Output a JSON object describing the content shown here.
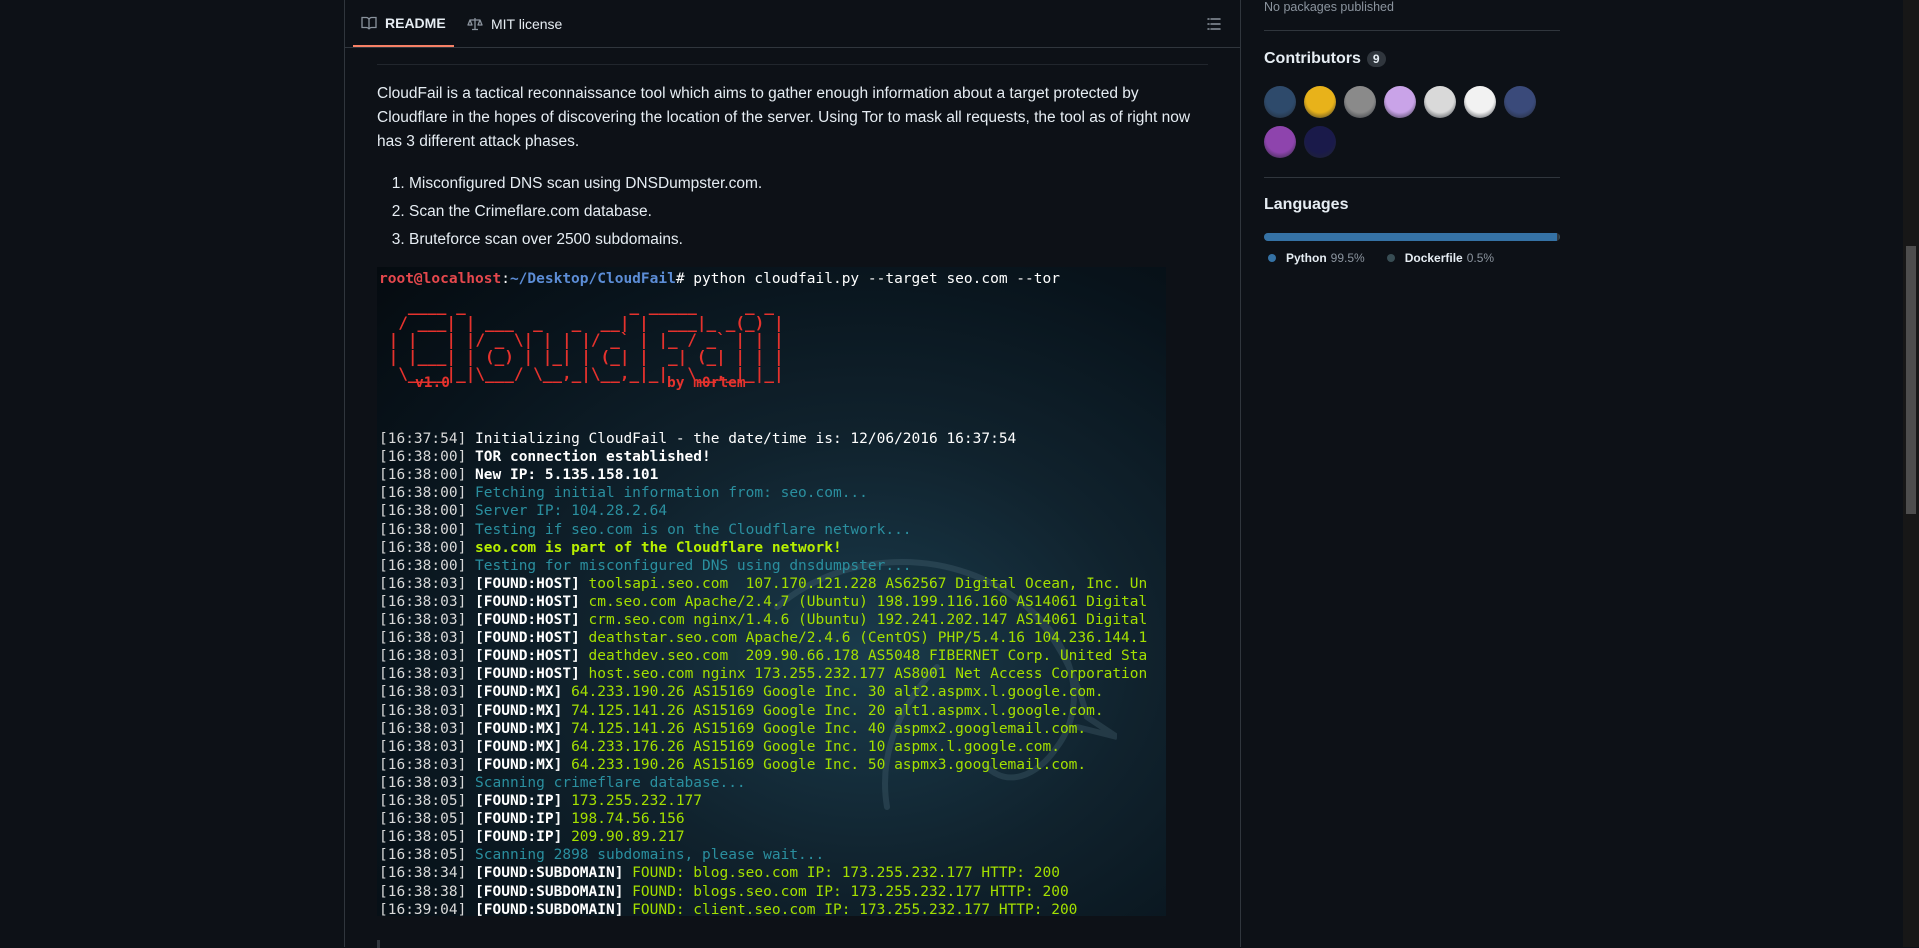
{
  "tabs": {
    "readme": "README",
    "license": "MIT license"
  },
  "intro": "CloudFail is a tactical reconnaissance tool which aims to gather enough information about a target protected by Cloudflare in the hopes of discovering the location of the server. Using Tor to mask all requests, the tool as of right now has 3 different attack phases.",
  "phases": [
    "Misconfigured DNS scan using DNSDumpster.com.",
    "Scan the Crimeflare.com database.",
    "Bruteforce scan over 2500 subdomains."
  ],
  "terminal": {
    "prompt_user": "root@localhost",
    "prompt_sep": ":",
    "prompt_path": "~/Desktop/CloudFail",
    "prompt_cmd": "# python cloudfail.py --target seo.com --tor",
    "ascii_art": "   ____ _                 _ _____     _ _ \n  / ___| | ___  _   _  __| |  ___|_ _(_) |\n | |   | |/ _ \\| | | |/ _` | |_ / _` | | |\n | |___| | (_) | |_| | (_| |  _| (_| | | |\n  \\____|_|\\___/ \\__,_|\\__,_|_|  \\__,_|_|_|",
    "version": "v1.0",
    "author": "by m0rtem",
    "lines": [
      {
        "ts": "[16:37:54]",
        "tag": "",
        "text": " Initializing CloudFail - the date/time is: 12/06/2016 16:37:54",
        "style": "white"
      },
      {
        "ts": "[16:38:00]",
        "tag": "",
        "text": " TOR connection established!",
        "style": "bold"
      },
      {
        "ts": "[16:38:00]",
        "tag": "",
        "text": " New IP: 5.135.158.101",
        "style": "bold"
      },
      {
        "ts": "[16:38:00]",
        "tag": "",
        "text": " Fetching initial information from: seo.com...",
        "style": "cyan"
      },
      {
        "ts": "[16:38:00]",
        "tag": "",
        "text": " Server IP: 104.28.2.64",
        "style": "cyan"
      },
      {
        "ts": "[16:38:00]",
        "tag": "",
        "text": " Testing if seo.com is on the Cloudflare network...",
        "style": "cyan"
      },
      {
        "ts": "[16:38:00]",
        "tag": "",
        "text": " seo.com is part of the Cloudflare network!",
        "style": "greenb"
      },
      {
        "ts": "[16:38:00]",
        "tag": "",
        "text": " Testing for misconfigured DNS using dnsdumpster...",
        "style": "cyan"
      },
      {
        "ts": "[16:38:03]",
        "tag": " [FOUND:HOST]",
        "text": " toolsapi.seo.com  107.170.121.228 AS62567 Digital Ocean, Inc. Un",
        "style": "green"
      },
      {
        "ts": "[16:38:03]",
        "tag": " [FOUND:HOST]",
        "text": " cm.seo.com Apache/2.4.7 (Ubuntu) 198.199.116.160 AS14061 Digital",
        "style": "green"
      },
      {
        "ts": "[16:38:03]",
        "tag": " [FOUND:HOST]",
        "text": " crm.seo.com nginx/1.4.6 (Ubuntu) 192.241.202.147 AS14061 Digital",
        "style": "green"
      },
      {
        "ts": "[16:38:03]",
        "tag": " [FOUND:HOST]",
        "text": " deathstar.seo.com Apache/2.4.6 (CentOS) PHP/5.4.16 104.236.144.1",
        "style": "green"
      },
      {
        "ts": "[16:38:03]",
        "tag": " [FOUND:HOST]",
        "text": " deathdev.seo.com  209.90.66.178 AS5048 FIBERNET Corp. United Sta",
        "style": "green"
      },
      {
        "ts": "[16:38:03]",
        "tag": " [FOUND:HOST]",
        "text": " host.seo.com nginx 173.255.232.177 AS8001 Net Access Corporation",
        "style": "green"
      },
      {
        "ts": "[16:38:03]",
        "tag": " [FOUND:MX]",
        "text": " 64.233.190.26 AS15169 Google Inc. 30 alt2.aspmx.l.google.com.",
        "style": "green"
      },
      {
        "ts": "[16:38:03]",
        "tag": " [FOUND:MX]",
        "text": " 74.125.141.26 AS15169 Google Inc. 20 alt1.aspmx.l.google.com.",
        "style": "green"
      },
      {
        "ts": "[16:38:03]",
        "tag": " [FOUND:MX]",
        "text": " 74.125.141.26 AS15169 Google Inc. 40 aspmx2.googlemail.com.",
        "style": "green"
      },
      {
        "ts": "[16:38:03]",
        "tag": " [FOUND:MX]",
        "text": " 64.233.176.26 AS15169 Google Inc. 10 aspmx.l.google.com.",
        "style": "green"
      },
      {
        "ts": "[16:38:03]",
        "tag": " [FOUND:MX]",
        "text": " 64.233.190.26 AS15169 Google Inc. 50 aspmx3.googlemail.com.",
        "style": "green"
      },
      {
        "ts": "[16:38:03]",
        "tag": "",
        "text": " Scanning crimeflare database...",
        "style": "cyan"
      },
      {
        "ts": "[16:38:05]",
        "tag": " [FOUND:IP]",
        "text": " 173.255.232.177",
        "style": "green"
      },
      {
        "ts": "[16:38:05]",
        "tag": " [FOUND:IP]",
        "text": " 198.74.56.156",
        "style": "green"
      },
      {
        "ts": "[16:38:05]",
        "tag": " [FOUND:IP]",
        "text": " 209.90.89.217",
        "style": "green"
      },
      {
        "ts": "[16:38:05]",
        "tag": "",
        "text": " Scanning 2898 subdomains, please wait...",
        "style": "cyan"
      },
      {
        "ts": "[16:38:34]",
        "tag": " [FOUND:SUBDOMAIN]",
        "text": " FOUND: blog.seo.com IP: 173.255.232.177 HTTP: 200",
        "style": "green"
      },
      {
        "ts": "[16:38:38]",
        "tag": " [FOUND:SUBDOMAIN]",
        "text": " FOUND: blogs.seo.com IP: 173.255.232.177 HTTP: 200",
        "style": "green"
      },
      {
        "ts": "[16:39:04]",
        "tag": " [FOUND:SUBDOMAIN]",
        "text": " FOUND: client.seo.com IP: 173.255.232.177 HTTP: 200",
        "style": "green"
      }
    ]
  },
  "sidebar": {
    "packages_text": "No packages published",
    "contributors_title": "Contributors",
    "contributors_count": "9",
    "contributors": [
      {
        "name": "contributor-1",
        "color": "#2e4a6b"
      },
      {
        "name": "contributor-2",
        "color": "#e8b21a"
      },
      {
        "name": "contributor-3",
        "color": "#8a8a8a"
      },
      {
        "name": "contributor-4",
        "color": "#c9a3e8"
      },
      {
        "name": "contributor-5",
        "color": "#d9d9d9"
      },
      {
        "name": "contributor-6",
        "color": "#f2f2f2"
      },
      {
        "name": "contributor-7",
        "color": "#3a4a7a"
      },
      {
        "name": "contributor-8",
        "color": "#8e44ad"
      },
      {
        "name": "contributor-9",
        "color": "#1a1a4a"
      }
    ],
    "languages_title": "Languages",
    "languages": [
      {
        "name": "Python",
        "percent": "99.5%",
        "value": 99.5,
        "color": "#3572A5"
      },
      {
        "name": "Dockerfile",
        "percent": "0.5%",
        "value": 0.5,
        "color": "#384d54"
      }
    ]
  }
}
